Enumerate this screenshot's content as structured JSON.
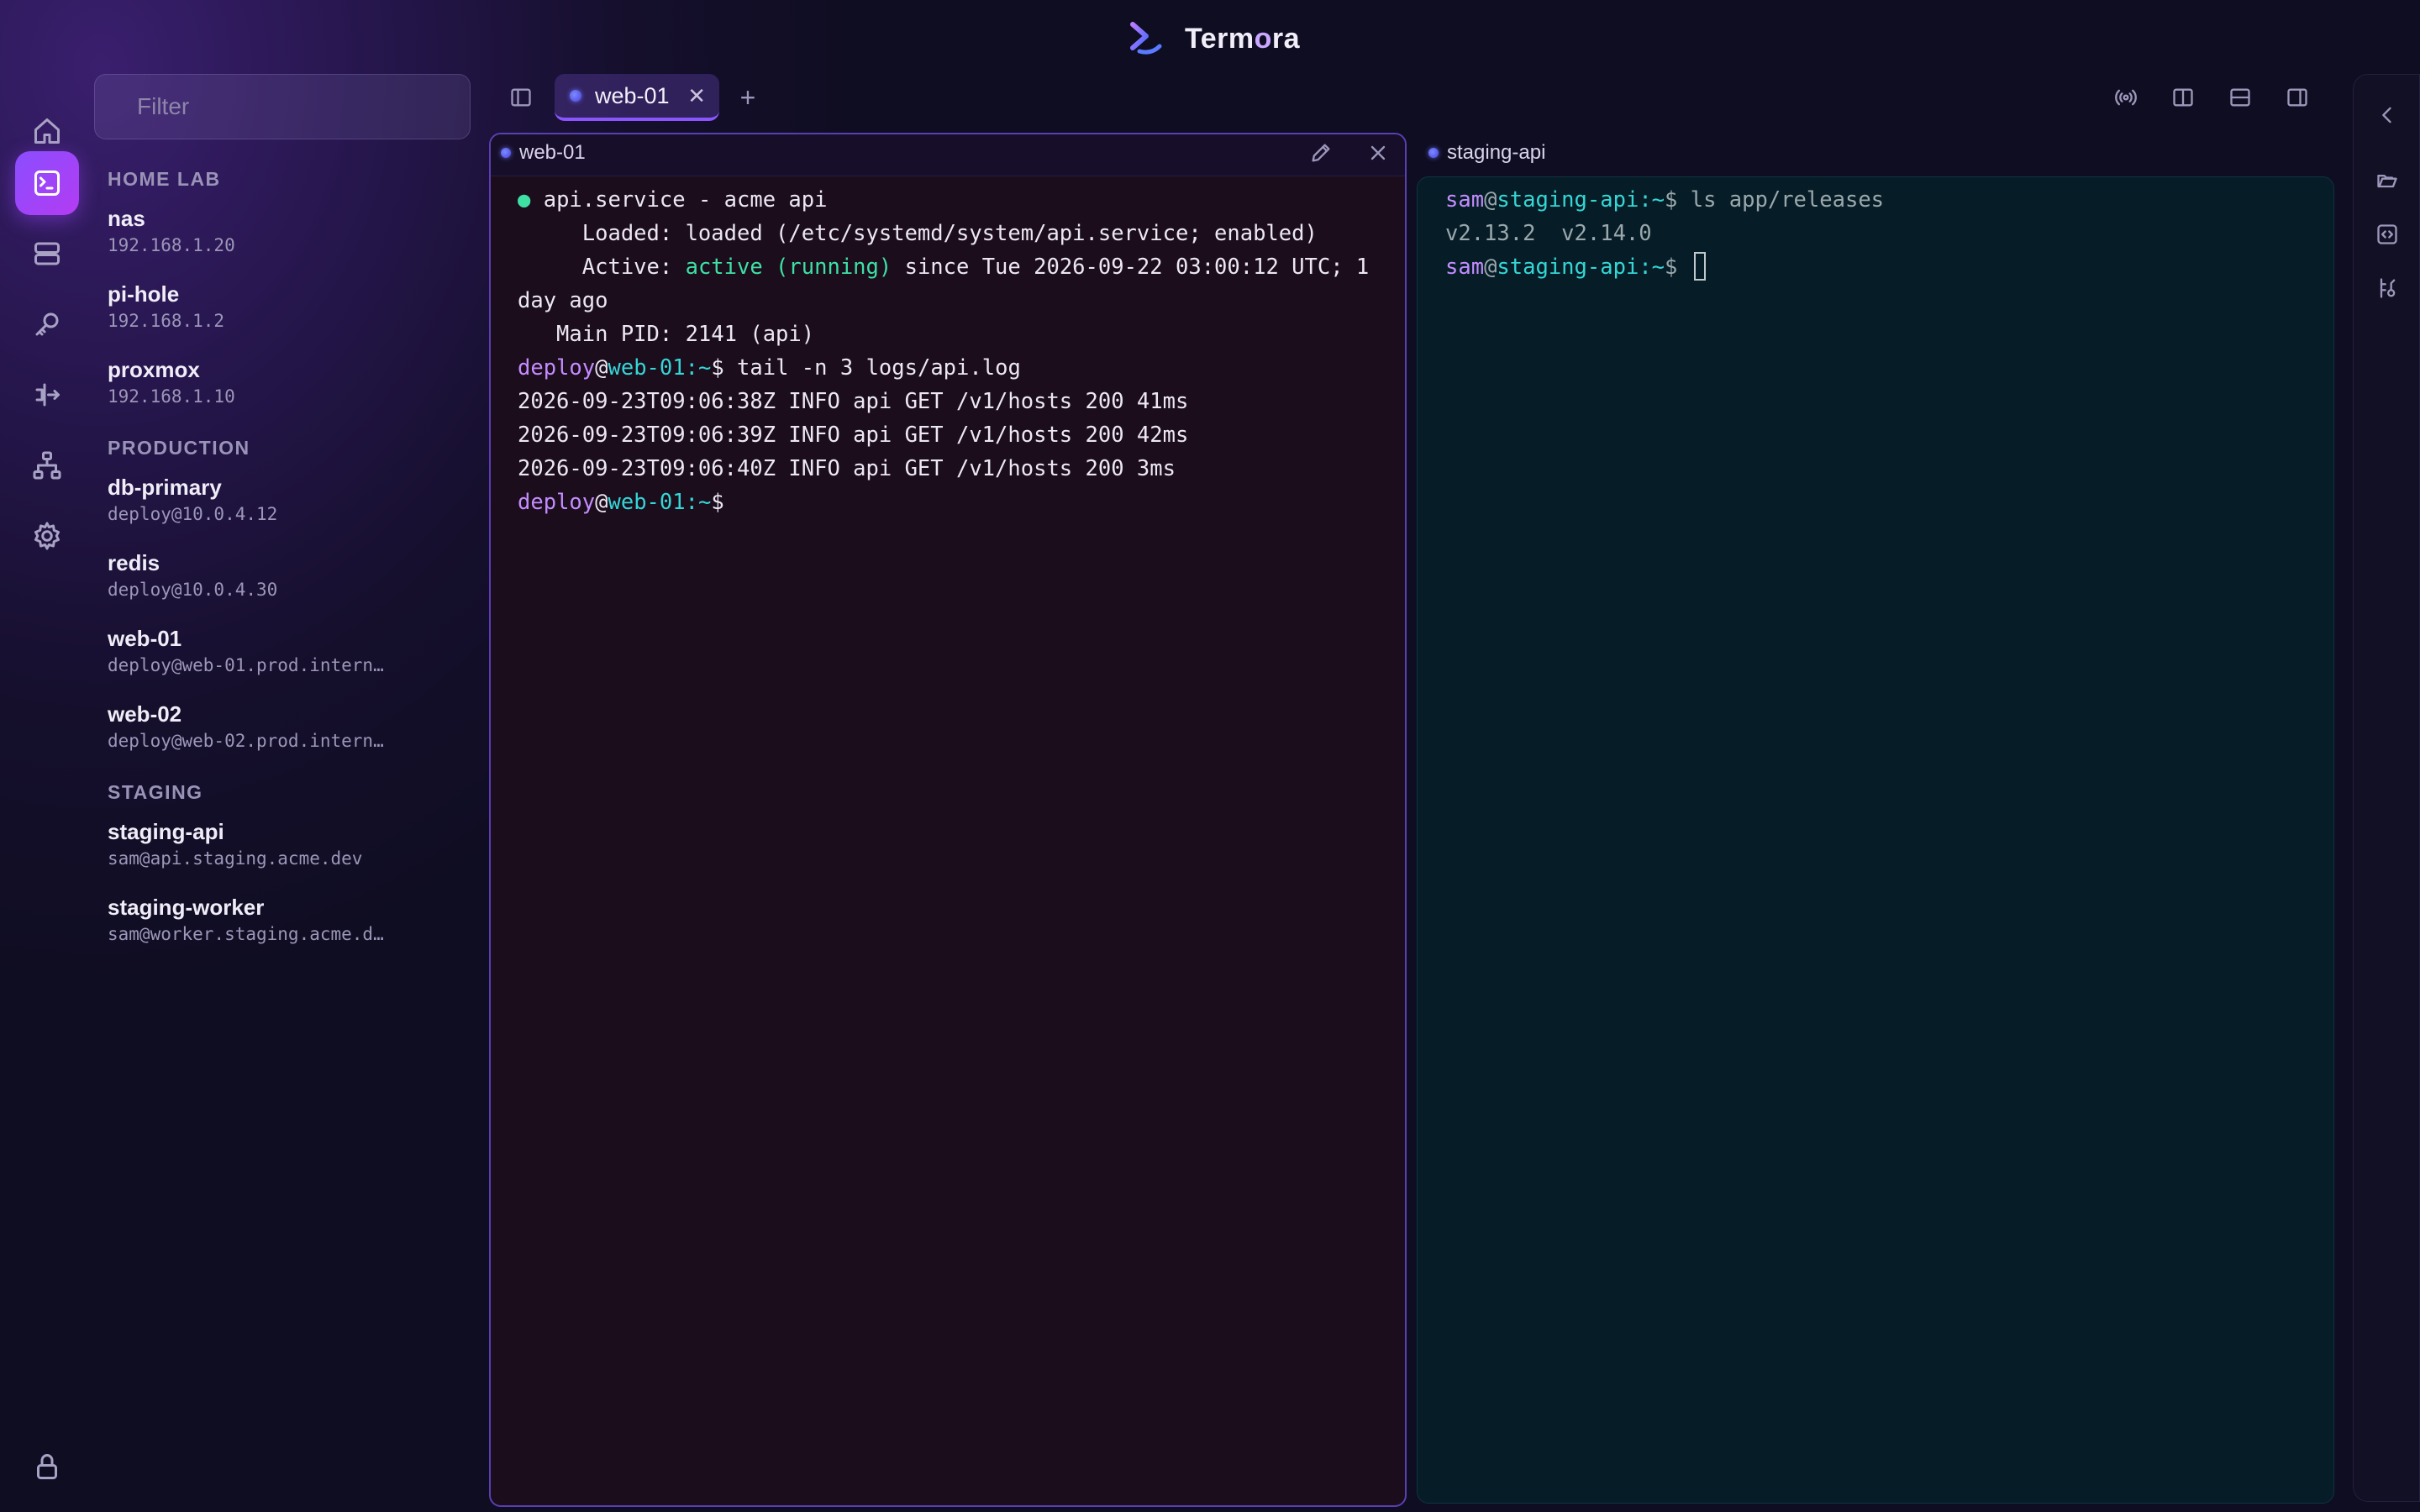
{
  "app": {
    "name_main": "Term",
    "name_hl": "o",
    "name_end": "ra"
  },
  "sidebar": {
    "filter_placeholder": "Filter",
    "groups": [
      {
        "label": "HOME LAB",
        "hosts": [
          {
            "name": "nas",
            "addr": "192.168.1.20"
          },
          {
            "name": "pi-hole",
            "addr": "192.168.1.2"
          },
          {
            "name": "proxmox",
            "addr": "192.168.1.10"
          }
        ]
      },
      {
        "label": "PRODUCTION",
        "hosts": [
          {
            "name": "db-primary",
            "addr": "deploy@10.0.4.12"
          },
          {
            "name": "redis",
            "addr": "deploy@10.0.4.30"
          },
          {
            "name": "web-01",
            "addr": "deploy@web-01.prod.intern…"
          },
          {
            "name": "web-02",
            "addr": "deploy@web-02.prod.intern…"
          }
        ]
      },
      {
        "label": "STAGING",
        "hosts": [
          {
            "name": "staging-api",
            "addr": "sam@api.staging.acme.dev"
          },
          {
            "name": "staging-worker",
            "addr": "sam@worker.staging.acme.d…"
          }
        ]
      }
    ]
  },
  "rail": {
    "items": [
      "home-icon",
      "terminal-icon",
      "servers-icon",
      "key-icon",
      "port-forward-icon",
      "network-icon",
      "gear-icon"
    ],
    "bottom": "lock-icon"
  },
  "tabs": [
    {
      "label": "web-01",
      "close": "✕"
    }
  ],
  "add_tab": "+",
  "panes": {
    "left": {
      "title": "web-01",
      "lines": {
        "l1_bullet": "●",
        "l1_text": " api.service - acme api",
        "l2": "     Loaded: loaded (/etc/systemd/system/api.service; enabled)",
        "l3_a": "     Active: ",
        "l3_b": "active (running)",
        "l3_c": " since Tue 2026-09-22 03:00:12 UTC; 1",
        "l4": "day ago",
        "l5": "   Main PID: 2141 (api)",
        "prompt_user": "deploy",
        "prompt_at": "@",
        "prompt_host": "web-01",
        "prompt_path": ":~",
        "prompt_sym": "$",
        "l6_cmd": " tail -n 3 logs/api.log",
        "l7": "2026-09-23T09:06:38Z INFO api GET /v1/hosts 200 41ms",
        "l8": "2026-09-23T09:06:39Z INFO api GET /v1/hosts 200 42ms",
        "l9": "2026-09-23T09:06:40Z INFO api GET /v1/hosts 200 3ms"
      }
    },
    "right": {
      "title": "staging-api",
      "lines": {
        "prompt_user": "sam",
        "prompt_at": "@",
        "prompt_host": "staging-api",
        "prompt_path": ":~",
        "prompt_sym": "$",
        "l1_cmd": " ls app/releases",
        "l2": "v2.13.2  v2.14.0"
      }
    }
  },
  "colors": {
    "accent": "#8b4dff",
    "prompt_user": "#c48cff",
    "prompt_host": "#34d6d6",
    "status_active": "#3ee0a4"
  }
}
